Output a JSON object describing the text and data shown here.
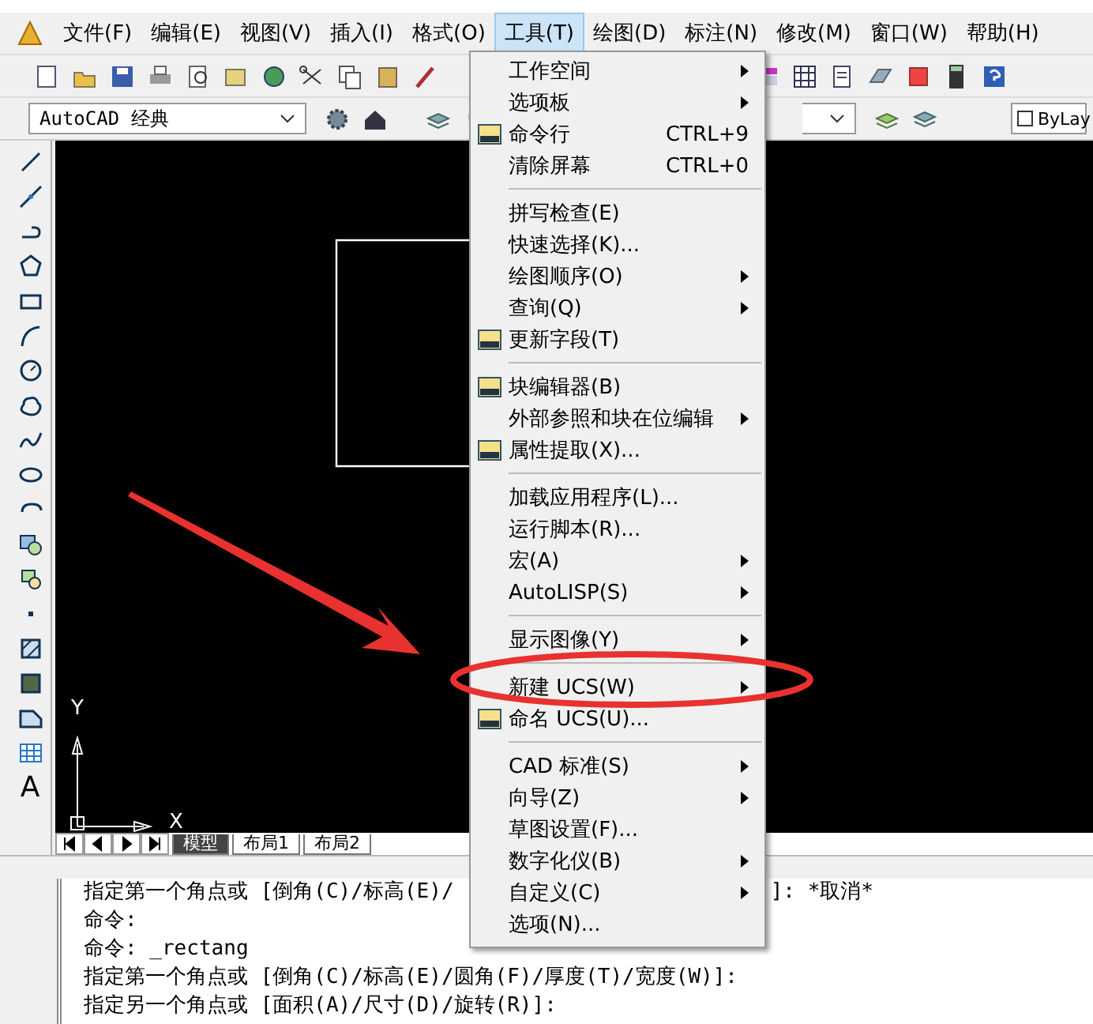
{
  "menu_bar": [
    {
      "label": "文件(F)",
      "selected": false
    },
    {
      "label": "编辑(E)",
      "selected": false
    },
    {
      "label": "视图(V)",
      "selected": false
    },
    {
      "label": "插入(I)",
      "selected": false
    },
    {
      "label": "格式(O)",
      "selected": false
    },
    {
      "label": "工具(T)",
      "selected": true
    },
    {
      "label": "绘图(D)",
      "selected": false
    },
    {
      "label": "标注(N)",
      "selected": false
    },
    {
      "label": "修改(M)",
      "selected": false
    },
    {
      "label": "窗口(W)",
      "selected": false
    },
    {
      "label": "帮助(H)",
      "selected": false
    }
  ],
  "workspace_dropdown": {
    "value": "AutoCAD 经典"
  },
  "color_dropdown": {
    "value": "ByLay"
  },
  "left_toolbar": {
    "text_tool": "A"
  },
  "drawing": {
    "ucs_x": "X",
    "ucs_y": "Y"
  },
  "layout_tabs": [
    {
      "label": "模型",
      "selected": true
    },
    {
      "label": "布局1",
      "selected": false
    },
    {
      "label": "布局2",
      "selected": false
    }
  ],
  "command_line": {
    "first_line_start": "指定第一个角点或 [倒角(C)/标高(E)/",
    "first_line_end": "]: *取消*",
    "lines": [
      "命令:",
      "命令: _rectang",
      "指定第一个角点或 [倒角(C)/标高(E)/圆角(F)/厚度(T)/宽度(W)]:",
      "指定另一个角点或 [面积(A)/尺寸(D)/旋转(R)]:"
    ]
  },
  "tools_menu": [
    {
      "kind": "item",
      "label": "工作空间",
      "submenu": true,
      "icon": false
    },
    {
      "kind": "item",
      "label": "选项板",
      "submenu": true,
      "icon": false
    },
    {
      "kind": "item",
      "label": "命令行",
      "shortcut": "CTRL+9",
      "submenu": false,
      "icon": true
    },
    {
      "kind": "item",
      "label": "清除屏幕",
      "shortcut": "CTRL+0",
      "submenu": false,
      "icon": false
    },
    {
      "kind": "separator"
    },
    {
      "kind": "item",
      "label": "拼写检查(E)",
      "submenu": false,
      "icon": false
    },
    {
      "kind": "item",
      "label": "快速选择(K)...",
      "submenu": false,
      "icon": false
    },
    {
      "kind": "item",
      "label": "绘图顺序(O)",
      "submenu": true,
      "icon": false
    },
    {
      "kind": "item",
      "label": "查询(Q)",
      "submenu": true,
      "icon": false
    },
    {
      "kind": "item",
      "label": "更新字段(T)",
      "submenu": false,
      "icon": true
    },
    {
      "kind": "separator"
    },
    {
      "kind": "item",
      "label": "块编辑器(B)",
      "submenu": false,
      "icon": true
    },
    {
      "kind": "item",
      "label": "外部参照和块在位编辑",
      "submenu": true,
      "icon": false
    },
    {
      "kind": "item",
      "label": "属性提取(X)...",
      "submenu": false,
      "icon": true
    },
    {
      "kind": "separator"
    },
    {
      "kind": "item",
      "label": "加载应用程序(L)...",
      "submenu": false,
      "icon": false
    },
    {
      "kind": "item",
      "label": "运行脚本(R)...",
      "submenu": false,
      "icon": false
    },
    {
      "kind": "item",
      "label": "宏(A)",
      "submenu": true,
      "icon": false
    },
    {
      "kind": "item",
      "label": "AutoLISP(S)",
      "submenu": true,
      "icon": false
    },
    {
      "kind": "separator"
    },
    {
      "kind": "item",
      "label": "显示图像(Y)",
      "submenu": true,
      "icon": false
    },
    {
      "kind": "separator"
    },
    {
      "kind": "item",
      "label": "新建 UCS(W)",
      "submenu": true,
      "icon": false
    },
    {
      "kind": "item",
      "label": "命名 UCS(U)...",
      "submenu": false,
      "icon": true
    },
    {
      "kind": "separator"
    },
    {
      "kind": "item",
      "label": "CAD 标准(S)",
      "submenu": true,
      "icon": false
    },
    {
      "kind": "item",
      "label": "向导(Z)",
      "submenu": true,
      "icon": false
    },
    {
      "kind": "item",
      "label": "草图设置(F)...",
      "submenu": false,
      "icon": false
    },
    {
      "kind": "item",
      "label": "数字化仪(B)",
      "submenu": true,
      "icon": false
    },
    {
      "kind": "item",
      "label": "自定义(C)",
      "submenu": true,
      "icon": false
    },
    {
      "kind": "item",
      "label": "选项(N)...",
      "submenu": false,
      "icon": false
    }
  ]
}
